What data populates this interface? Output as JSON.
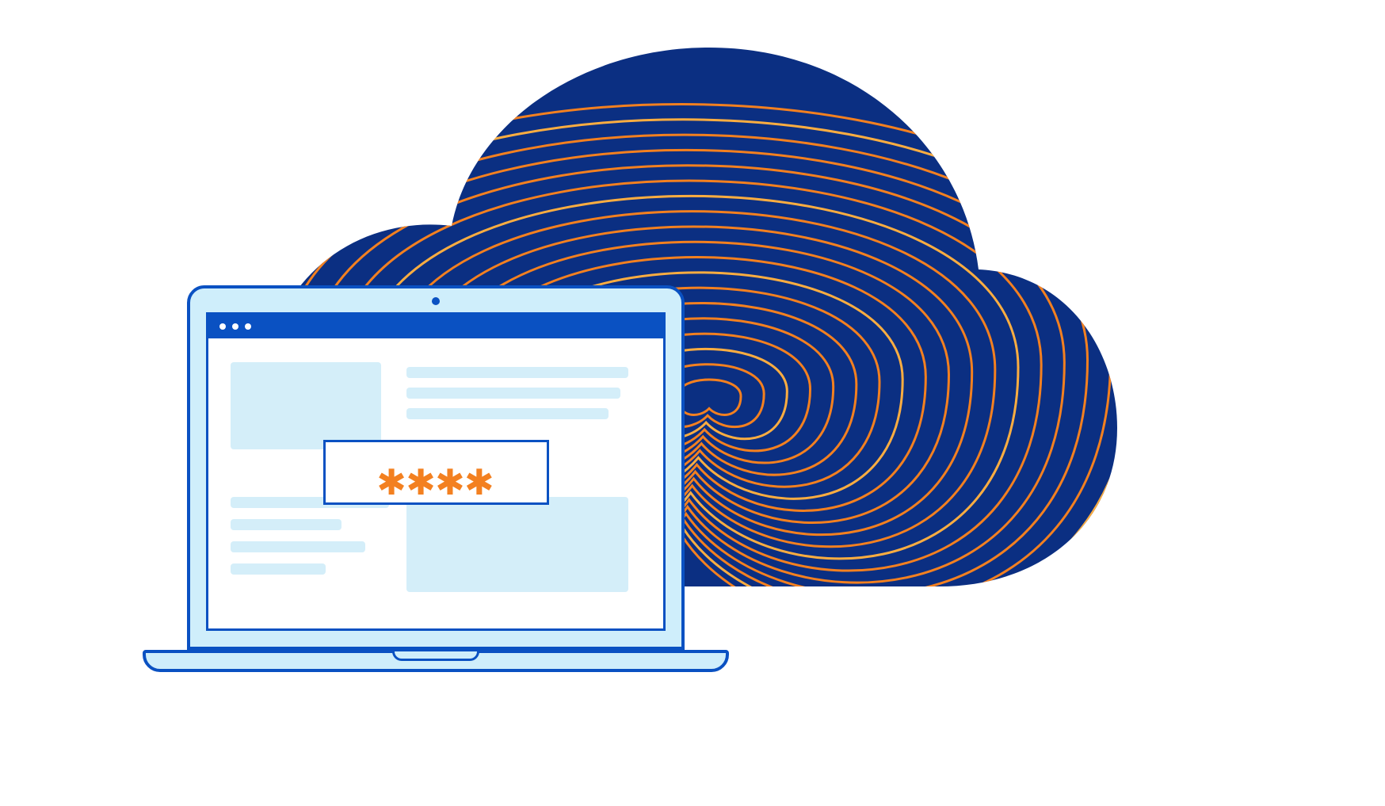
{
  "illustration": {
    "description": "Laptop with masked password field in front of a cloud with concentric contour lines",
    "password_mask": "✱✱✱✱",
    "browser_dots": 3
  },
  "colors": {
    "cloud_fill": "#0b2f82",
    "outline_blue": "#0a51c2",
    "laptop_body": "#cfeefb",
    "placeholder": "#d4eef9",
    "accent_orange": "#f38020",
    "accent_yellow": "#fbad41",
    "white": "#ffffff"
  }
}
